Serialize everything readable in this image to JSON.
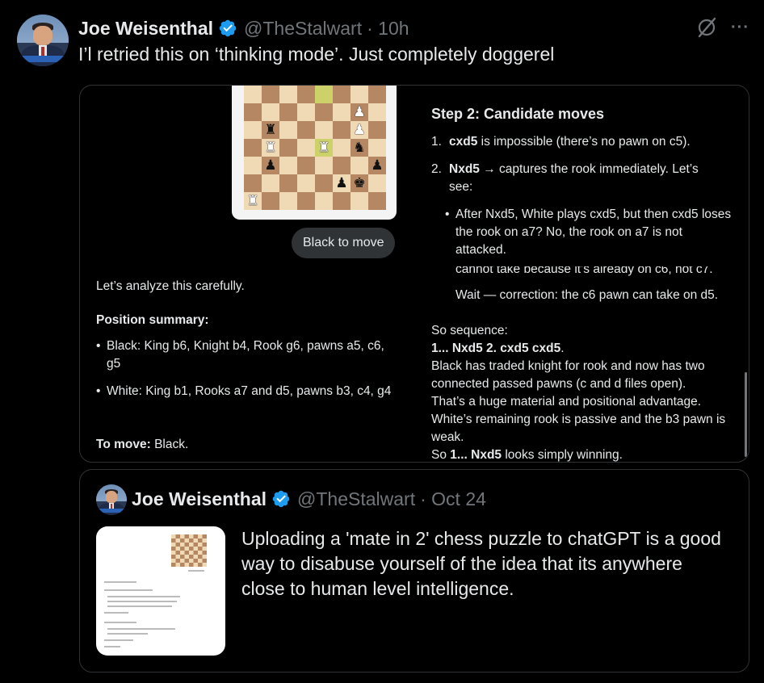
{
  "tweet": {
    "author_name": "Joe Weisenthal",
    "handle": "@TheStalwart",
    "time": "· 10h",
    "text": "I’l retried this on ‘thinking mode’. Just completely doggerel",
    "more_label": "···",
    "icons": [
      "avatar",
      "verified-badge-icon",
      "grok-icon",
      "more-icon"
    ],
    "colors": {
      "verified": "#1d9bf0",
      "secondary_text": "#71767b",
      "border": "#2f3336"
    }
  },
  "screenshot": {
    "caption": "Black to move",
    "intro": "Let’s analyze this carefully.",
    "position_summary_heading": "Position summary:",
    "black_summary": "Black: King b6, Knight b4, Rook g6, pawns a5, c6, g5",
    "white_summary": "White: King b1, Rooks a7 and d5, pawns b3, c4, g4",
    "to_move_label": "To move:",
    "to_move_value": "Black.",
    "step2_heading": "Step 2: Candidate moves",
    "m1_bold": "cxd5",
    "m1_rest": "is impossible (there’s no pawn on c5).",
    "m2_bold": "Nxd5",
    "m2_rest": "→ captures the rook immediately. Let’s see:",
    "sub_bullet": "After Nxd5, White plays cxd5, but then cxd5 loses the rook on a7? No, the rook on a7 is not attacked.",
    "garbled_line": "cannot take because it’s already on c6, not c7.",
    "wait_line": "Wait — correction: the c6 pawn can take on d5.",
    "so_sequence": "So sequence:",
    "sequence_moves": "1... Nxd5 2. cxd5 cxd5",
    "sequence_end": ".",
    "analysis_1": "Black has traded knight for rook and now has two connected passed pawns (c and d files open).",
    "analysis_2": "That’s a huge material and positional advantage.",
    "analysis_3": "White’s remaining rook is passive and the b3 pawn is weak.",
    "conclusion_prefix": "So",
    "conclusion_move": "1... Nxd5",
    "conclusion_suffix": "looks simply winning.",
    "board": {
      "rows": [
        [
          "",
          "",
          "",
          "",
          "",
          "",
          "",
          ""
        ],
        [
          "",
          "",
          "",
          "",
          "",
          "",
          "wP",
          ""
        ],
        [
          "",
          "bR",
          "",
          "",
          "",
          "",
          "wP",
          ""
        ],
        [
          "",
          "wR",
          "",
          "",
          "wR",
          "",
          "bN",
          ""
        ],
        [
          "",
          "bP",
          "",
          "",
          "",
          "",
          "",
          "bP"
        ],
        [
          "",
          "",
          "",
          "",
          "",
          "bP",
          "bK",
          ""
        ],
        [
          "wR",
          "",
          "",
          "",
          "",
          "",
          "",
          ""
        ]
      ],
      "highlight_squares": [
        [
          0,
          4
        ],
        [
          3,
          4
        ]
      ]
    }
  },
  "quoted_tweet": {
    "author_name": "Joe Weisenthal",
    "handle": "@TheStalwart",
    "time": "· Oct 24",
    "text": "Uploading a 'mate in 2' chess puzzle to chatGPT is a good way to disabuse yourself of the idea that its anywhere close to human level intelligence."
  }
}
